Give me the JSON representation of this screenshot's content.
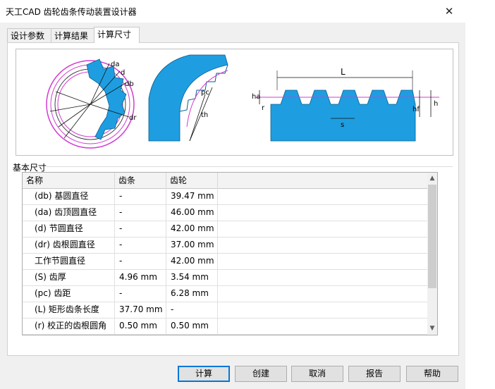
{
  "window": {
    "title": "天工CAD 齿轮齿条传动装置设计器",
    "close_glyph": "✕"
  },
  "tabs": [
    {
      "label": "设计参数"
    },
    {
      "label": "计算结果"
    },
    {
      "label": "计算尺寸",
      "active": true
    }
  ],
  "diagram": {
    "gear_labels": {
      "da": "da",
      "d": "d",
      "db": "db",
      "dr": "dr"
    },
    "pitch_labels": {
      "pc": "pc",
      "th": "th"
    },
    "rack_labels": {
      "L": "L",
      "ha": "ha",
      "r": "r",
      "hf": "hf",
      "h": "h",
      "s": "s"
    }
  },
  "section": {
    "label": "基本尺寸"
  },
  "table": {
    "columns": [
      "名称",
      "齿条",
      "齿轮"
    ],
    "rows": [
      [
        "(db) 基圆直径",
        "-",
        "39.47 mm"
      ],
      [
        "(da) 齿顶圆直径",
        "-",
        "46.00 mm"
      ],
      [
        "(d) 节圆直径",
        "-",
        "42.00 mm"
      ],
      [
        "(dr) 齿根圆直径",
        "-",
        "37.00 mm"
      ],
      [
        "工作节圆直径",
        "-",
        "42.00 mm"
      ],
      [
        "(S) 齿厚",
        "4.96 mm",
        "3.54 mm"
      ],
      [
        "(pc) 齿距",
        "-",
        "6.28 mm"
      ],
      [
        "(L) 矩形齿条长度",
        "37.70 mm",
        "-"
      ],
      [
        "(r) 校正的齿根圆角",
        "0.50 mm",
        "0.50 mm"
      ]
    ]
  },
  "buttons": [
    {
      "label": "计算",
      "default": true
    },
    {
      "label": "创建"
    },
    {
      "label": "取消"
    },
    {
      "label": "报告"
    },
    {
      "label": "帮助"
    }
  ],
  "colors": {
    "gear_fill": "#1e9ee0",
    "magenta": "#d23cd2",
    "accent": "#0078d7"
  }
}
